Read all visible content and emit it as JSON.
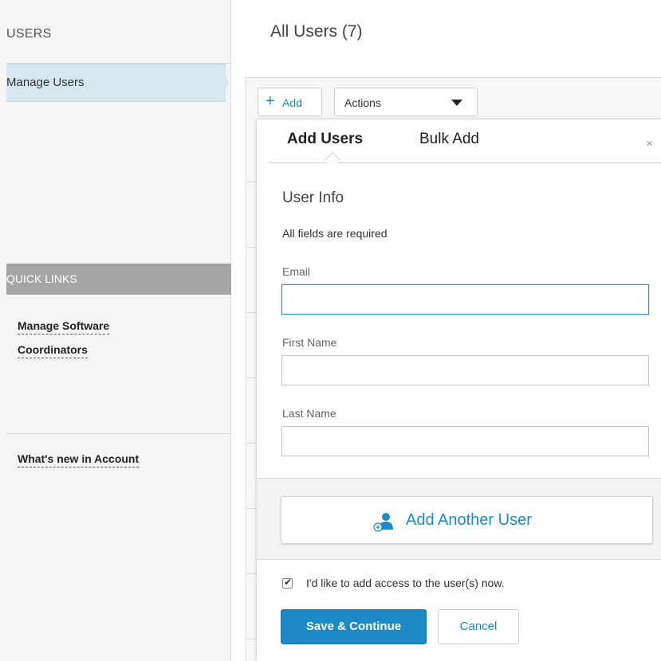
{
  "sidebar": {
    "heading": "USERS",
    "active_item": "Manage Users",
    "quick_links_header": "QUICK LINKS",
    "links": [
      {
        "label_line1": "Manage Software",
        "label_line2": "Coordinators"
      },
      {
        "label": "What's new in Account"
      }
    ]
  },
  "header": {
    "title": "All Users (7)"
  },
  "toolbar": {
    "add_label": "Add",
    "actions_label": "Actions"
  },
  "modal": {
    "tabs": [
      "Add Users",
      "Bulk Add"
    ],
    "close_icon": "×",
    "section_title": "User Info",
    "required_note": "All fields are required",
    "fields": {
      "email_label": "Email",
      "email_value": "",
      "first_name_label": "First Name",
      "first_name_value": "",
      "last_name_label": "Last Name",
      "last_name_value": ""
    },
    "add_another_label": "Add Another User",
    "add_access_checkbox": {
      "checked": true,
      "label": "I'd like to add access to the user(s) now."
    },
    "save_label": "Save & Continue",
    "cancel_label": "Cancel"
  },
  "colors": {
    "accent": "#1b8ac7",
    "active_nav_bg": "#d7e7ef",
    "quick_links_bg": "#a5a5a5"
  }
}
